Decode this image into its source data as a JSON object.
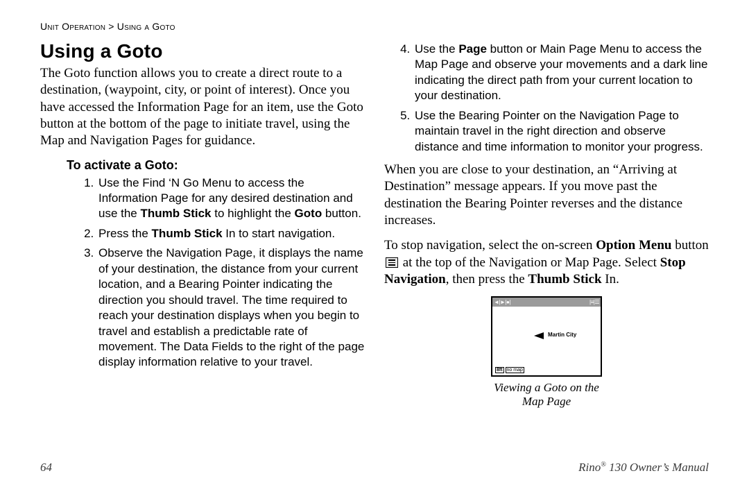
{
  "breadcrumb": {
    "section": "Unit Operation",
    "separator": ">",
    "subsection": "Using a Goto"
  },
  "title": "Using a Goto",
  "intro": "The Goto function allows you to create a direct route to a destination, (waypoint, city, or point of interest). Once you have accessed the Information Page for an item, use the Goto button at the bottom of the page to initiate travel, using the Map and Navigation Pages for guidance.",
  "subheading": "To activate a Goto:",
  "steps": {
    "s1a": "Use the Find ‘N Go Menu to access the Information Page for any desired destination and use the ",
    "s1b": "Thumb Stick",
    "s1c": " to highlight the ",
    "s1d": "Goto",
    "s1e": " button.",
    "s2a": "Press the ",
    "s2b": "Thumb Stick",
    "s2c": " In to start navigation.",
    "s3": "Observe the Navigation Page, it displays the name of your destination, the distance from your current location, and a Bearing Pointer indicating the direction you should travel. The time required to reach your destination displays when you begin to travel and establish a predictable rate of movement. The Data Fields to the right of the page display information relative to your travel.",
    "s4a": "Use the ",
    "s4b": "Page",
    "s4c": " button or Main Page Menu to access the Map Page and observe your movements and a dark line indicating the direct path from your current location to your destination.",
    "s5": "Use the Bearing Pointer on the Navigation Page to maintain travel in the right direction and observe distance and time information to monitor your progress."
  },
  "para2": "When you are close to your destination, an “Arriving at Destination” message appears. If you move past the destination the Bearing Pointer reverses and the distance increases.",
  "para3": {
    "a": "To stop navigation, select the on-screen ",
    "b": "Option Menu",
    "c": " button ",
    "d": " at the top of the Navigation or Map Page. Select ",
    "e": "Stop Navigation",
    "f": ", then press the ",
    "g": "Thumb Stick",
    "h": " In."
  },
  "figure": {
    "topleft": "◄|►|●|",
    "topright": "|≡|☰",
    "city": "Martin City",
    "scale1": "8ft",
    "scale2": "no map",
    "caption": "Viewing a Goto on the Map Page"
  },
  "footer": {
    "page": "64",
    "doc1": "Rino",
    "doc2": "®",
    "doc3": " 130 Owner’s Manual"
  }
}
